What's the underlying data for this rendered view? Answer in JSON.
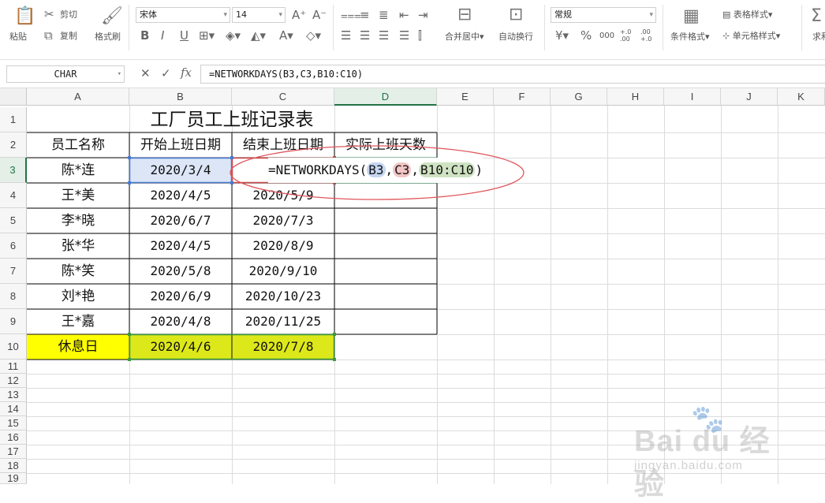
{
  "ribbon": {
    "clipboard": {
      "paste": "粘贴",
      "cut": "剪切",
      "copy": "复制",
      "format_painter": "格式刷"
    },
    "font": {
      "name": "宋体",
      "size": "14",
      "bold": "B",
      "italic": "I",
      "underline": "U",
      "font_color": "A"
    },
    "alignment": {
      "merge_center": "合并居中",
      "wrap_text": "自动换行"
    },
    "number": {
      "format": "常规",
      "currency": "¥",
      "percent": "%",
      "thousands": "000",
      "inc_decimal": "+.0 .00",
      "dec_decimal": ".00 +.0"
    },
    "styles": {
      "conditional_format": "条件格式",
      "table_style": "表格样式",
      "cell_style": "单元格样式",
      "sum": "求和"
    }
  },
  "formula_bar": {
    "name_box": "CHAR",
    "cancel": "✕",
    "confirm": "✓",
    "fx": "fx",
    "formula": "=NETWORKDAYS(B3,C3,B10:C10)"
  },
  "columns": [
    "A",
    "B",
    "C",
    "D",
    "E",
    "F",
    "G",
    "H",
    "I",
    "J",
    "K"
  ],
  "rows": [
    "1",
    "2",
    "3",
    "4",
    "5",
    "6",
    "7",
    "8",
    "9",
    "10",
    "11",
    "12",
    "13",
    "14",
    "15",
    "16",
    "17",
    "18",
    "19"
  ],
  "table": {
    "title": "工厂员工上班记录表",
    "headers": [
      "员工名称",
      "开始上班日期",
      "结束上班日期",
      "实际上班天数"
    ],
    "rows": [
      {
        "name": "陈*连",
        "start": "2020/3/4",
        "end": ""
      },
      {
        "name": "王*美",
        "start": "2020/4/5",
        "end": "2020/5/9"
      },
      {
        "name": "李*晓",
        "start": "2020/6/7",
        "end": "2020/7/3"
      },
      {
        "name": "张*华",
        "start": "2020/4/5",
        "end": "2020/8/9"
      },
      {
        "name": "陈*笑",
        "start": "2020/5/8",
        "end": "2020/9/10"
      },
      {
        "name": "刘*艳",
        "start": "2020/6/9",
        "end": "2020/10/23"
      },
      {
        "name": "王*嘉",
        "start": "2020/4/8",
        "end": "2020/11/25"
      }
    ],
    "holiday": {
      "name": "休息日",
      "start": "2020/4/6",
      "end": "2020/7/8"
    }
  },
  "edit_formula": {
    "prefix": "=NETWORKDAYS(",
    "arg1": "B3",
    "sep1": ",",
    "arg2": "C3",
    "sep2": ",",
    "arg3": "B10:C10",
    "suffix": ")"
  },
  "watermark": {
    "brand": "Bai du 经验",
    "url": "jingyan.baidu.com"
  },
  "colors": {
    "accent_green": "#217346",
    "holiday_fill": "#ffff00",
    "holiday_sel_fill": "#dde81a",
    "ref_blue": "#4a7bd1",
    "ref_red": "#d04a4a",
    "ref_green": "#3c9a3c",
    "annotation_red": "#e0565c"
  }
}
